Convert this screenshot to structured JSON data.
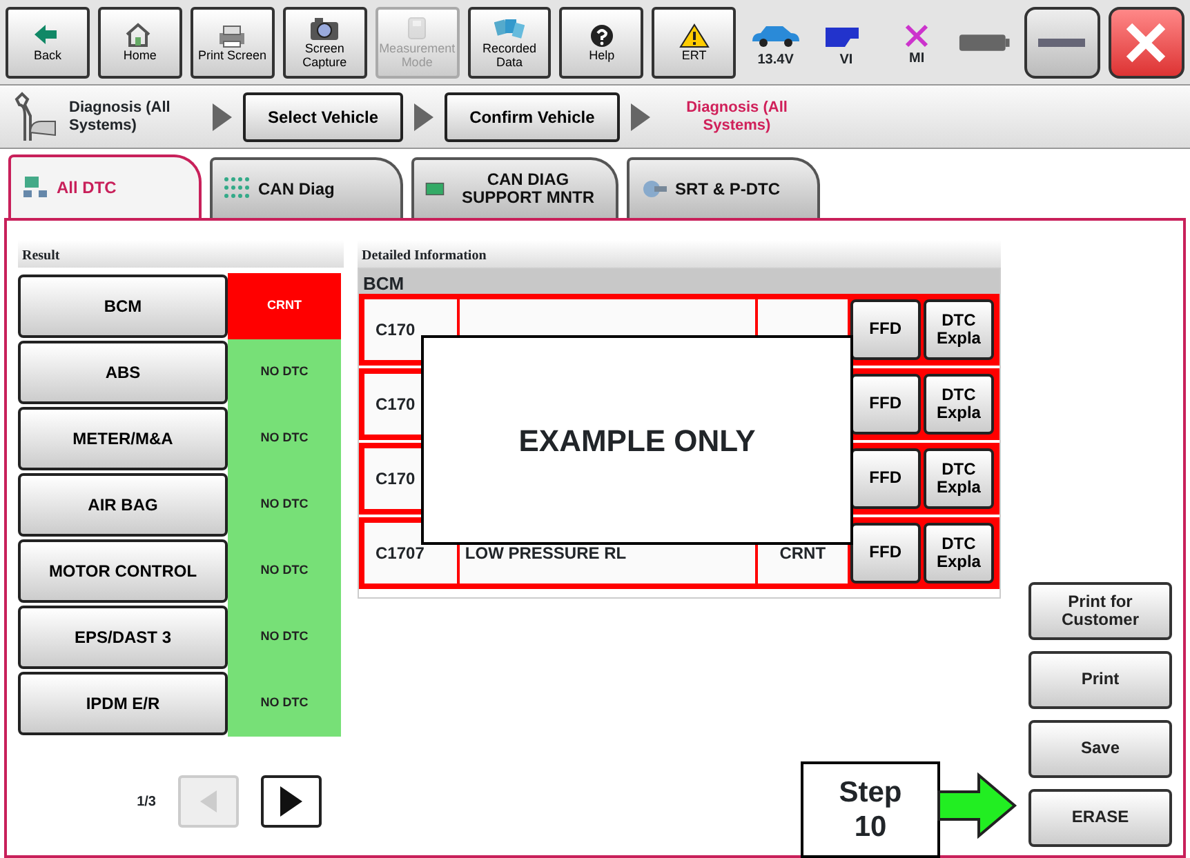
{
  "toolbar": {
    "buttons": [
      {
        "label": "Back",
        "disabled": false
      },
      {
        "label": "Home",
        "disabled": false
      },
      {
        "label": "Print Screen",
        "disabled": false
      },
      {
        "label": "Screen Capture",
        "disabled": false
      },
      {
        "label": "Measurement Mode",
        "disabled": true
      },
      {
        "label": "Recorded Data",
        "disabled": false
      },
      {
        "label": "Help",
        "disabled": false
      },
      {
        "label": "ERT",
        "disabled": false
      }
    ],
    "status": [
      {
        "label": "13.4V"
      },
      {
        "label": "VI"
      },
      {
        "label": "MI"
      }
    ]
  },
  "breadcrumb": {
    "section": "Diagnosis (All Systems)",
    "steps": [
      "Select Vehicle",
      "Confirm Vehicle"
    ],
    "current": "Diagnosis (All Systems)"
  },
  "tabs": [
    {
      "label": "All DTC",
      "selected": true
    },
    {
      "label": "CAN Diag",
      "selected": false
    },
    {
      "label": "CAN DIAG SUPPORT MNTR",
      "selected": false
    },
    {
      "label": "SRT & P-DTC",
      "selected": false
    }
  ],
  "result": {
    "title": "Result",
    "systems": [
      {
        "name": "BCM",
        "status": "CRNT",
        "color": "#ff0000"
      },
      {
        "name": "ABS",
        "status": "NO DTC",
        "color": "#77e077"
      },
      {
        "name": "METER/M&A",
        "status": "NO DTC",
        "color": "#77e077"
      },
      {
        "name": "AIR BAG",
        "status": "NO DTC",
        "color": "#77e077"
      },
      {
        "name": "MOTOR CONTROL",
        "status": "NO DTC",
        "color": "#77e077"
      },
      {
        "name": "EPS/DAST 3",
        "status": "NO DTC",
        "color": "#77e077"
      },
      {
        "name": "IPDM E/R",
        "status": "NO DTC",
        "color": "#77e077"
      }
    ],
    "pager": {
      "text": "1/3",
      "prev_disabled": true
    }
  },
  "detail": {
    "title": "Detailed Information",
    "module": "BCM",
    "rows": [
      {
        "code": "C170",
        "buttons": [
          "FFD",
          "DTC Expla"
        ]
      },
      {
        "code": "C170",
        "buttons": [
          "FFD",
          "DTC Expla"
        ]
      },
      {
        "code": "C170",
        "buttons": [
          "FFD",
          "DTC Expla"
        ]
      },
      {
        "code": "C1707",
        "description": "LOW PRESSURE RL",
        "status": "CRNT",
        "buttons": [
          "FFD",
          "DTC Expla"
        ]
      }
    ]
  },
  "side_buttons": [
    "Print for Customer",
    "Print",
    "Save",
    "ERASE"
  ],
  "annotations": {
    "note": "EXAMPLE ONLY",
    "step": "Step 10"
  }
}
